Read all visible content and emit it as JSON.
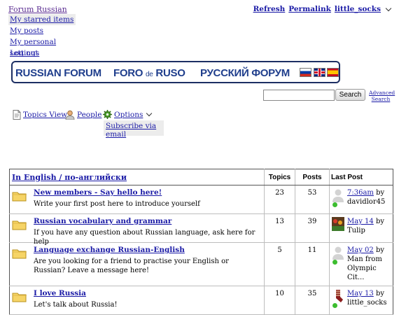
{
  "header": {
    "site_link": "Forum Russian",
    "refresh": "Refresh",
    "permalink": "Permalink",
    "username": "little_socks"
  },
  "user_menu": {
    "items": [
      "My starred items",
      "My posts",
      "My personal settings",
      "Log out"
    ]
  },
  "banner": {
    "english": "RUSSIAN FORUM",
    "spanish_a": "FORO",
    "spanish_de": "de",
    "spanish_b": "RUSO",
    "russian": "РУССКИЙ ФОРУМ"
  },
  "search": {
    "placeholder": "",
    "button": "Search",
    "advanced": "Advanced Search"
  },
  "nav": {
    "topics_view": "Topics View",
    "people": "People",
    "options": "Options",
    "subscribe": "Subscribe via email"
  },
  "table": {
    "category": "In English / по-английски",
    "col_topics": "Topics",
    "col_posts": "Posts",
    "col_last_post": "Last Post",
    "rows": [
      {
        "title": "New members - Say hello here!",
        "description": "Write your first post here to introduce yourself",
        "topics": "23",
        "posts": "53",
        "last_post_link": "7:36am",
        "last_post_by": "by",
        "last_post_user": "davidlor45"
      },
      {
        "title": "Russian vocabulary and grammar",
        "description": "If you have any question about Russian language, ask here for help",
        "topics": "13",
        "posts": "39",
        "last_post_link": "May 14",
        "last_post_by": "by",
        "last_post_user": "Tulip"
      },
      {
        "title": "Language exchange Russian-English",
        "description": "Are you looking for a friend to practise your English or Russian? Leave a message here!",
        "topics": "5",
        "posts": "11",
        "last_post_link": "May 02",
        "last_post_by": "by",
        "last_post_user": "Man from Olympic Cit..."
      },
      {
        "title": "I love Russia",
        "description": "Let's talk about Russia!",
        "topics": "10",
        "posts": "35",
        "last_post_link": "May 13",
        "last_post_by": "by",
        "last_post_user": "little_socks"
      }
    ]
  },
  "colors": {
    "link": "#1a1aa6",
    "banner_text": "#1f3e8c",
    "online": "#3cbd2f"
  }
}
